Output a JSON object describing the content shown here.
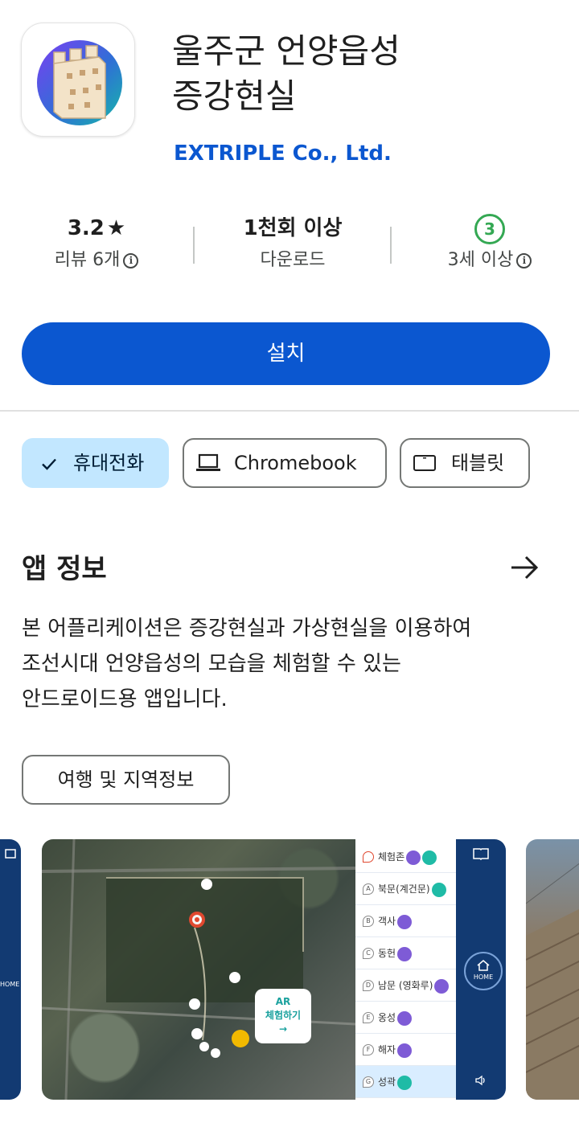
{
  "app": {
    "title_line1": "울주군 언양읍성",
    "title_line2": "증강현실",
    "developer": "EXTRIPLE Co., Ltd."
  },
  "stats": {
    "rating": "3.2",
    "rating_star": "★",
    "reviews_label": "리뷰 6개",
    "downloads": "1천회 이상",
    "downloads_label": "다운로드",
    "age_badge": "3",
    "age_label": "3세 이상"
  },
  "install_button": "설치",
  "device_chips": [
    {
      "label": "휴대전화",
      "selected": true
    },
    {
      "label": "Chromebook",
      "selected": false
    },
    {
      "label": "태블릿",
      "selected": false
    }
  ],
  "about": {
    "title": "앱 정보",
    "description_lines": [
      "본 어플리케이션은 증강현실과 가상현실을 이용하여",
      "조선시대 언양읍성의 모습을 체험할 수 있는",
      "안드로이드용 앱입니다."
    ],
    "category_chip": "여행 및 지역정보"
  },
  "screenshot_main": {
    "list_items": [
      {
        "marker": "",
        "label": "체험존"
      },
      {
        "marker": "A",
        "label": "북문(계건문)"
      },
      {
        "marker": "B",
        "label": "객사"
      },
      {
        "marker": "C",
        "label": "동헌"
      },
      {
        "marker": "D",
        "label": "남문 (영화루)"
      },
      {
        "marker": "E",
        "label": "옹성"
      },
      {
        "marker": "F",
        "label": "해자"
      },
      {
        "marker": "G",
        "label": "성곽"
      }
    ],
    "home_label": "HOME",
    "ar_card_line1": "AR",
    "ar_card_line2": "체험하기",
    "ar_card_arrow": "→"
  },
  "screenshot_left": {
    "home_label": "HOME"
  },
  "colors": {
    "primary": "#0b57d0",
    "chip_selected": "#c2e7ff",
    "age_green": "#34a853"
  }
}
